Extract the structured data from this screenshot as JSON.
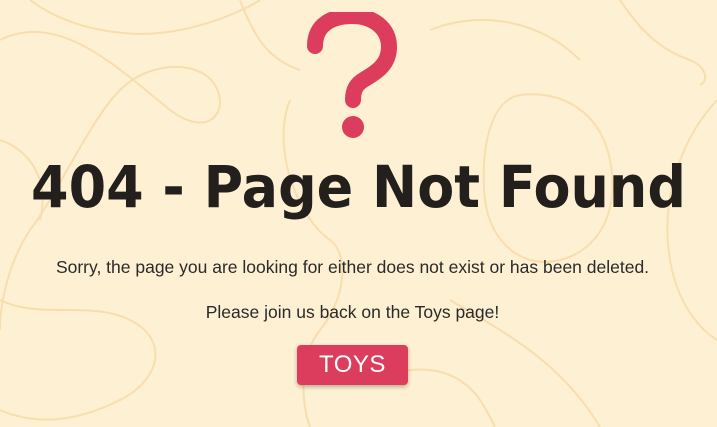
{
  "page": {
    "title": "404 - Page Not Found",
    "message_primary": "Sorry, the page you are looking for either does not exist or has been deleted.",
    "message_secondary": "Please join us back on the Toys page!",
    "toys_button_label": "TOYS"
  },
  "icons": {
    "hero_icon": "question-mark-icon"
  },
  "colors": {
    "background": "#fef0d2",
    "accent": "#dd3d5c",
    "title_text": "#231f1d",
    "body_text": "#2a2a2a",
    "background_lines": "#f8dcaa"
  }
}
